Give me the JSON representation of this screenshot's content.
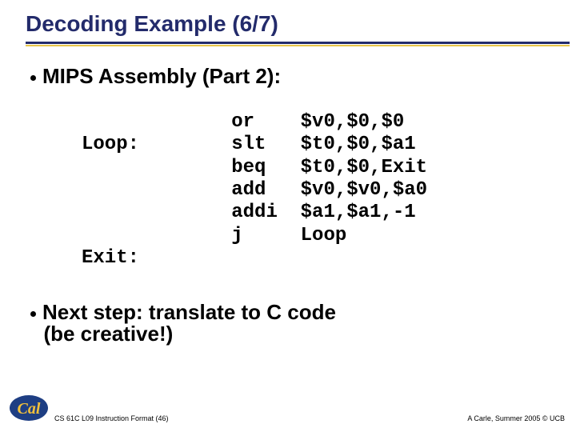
{
  "title": "Decoding Example (6/7)",
  "heading1": "MIPS Assembly (Part 2):",
  "code": "             or    $v0,$0,$0\nLoop:        slt   $t0,$0,$a1\n             beq   $t0,$0,Exit\n             add   $v0,$v0,$a0\n             addi  $a1,$a1,-1\n             j     Loop\nExit:",
  "heading2_line1": "Next step: translate to C code",
  "heading2_line2": "(be creative!)",
  "footer_left": "CS 61C L09 Instruction Format (46)",
  "footer_right": "A Carle, Summer 2005 © UCB",
  "chart_data": {
    "type": "table",
    "title": "MIPS Assembly (Part 2)",
    "columns": [
      "label",
      "instruction",
      "operands"
    ],
    "rows": [
      {
        "label": "",
        "instruction": "or",
        "operands": "$v0,$0,$0"
      },
      {
        "label": "Loop:",
        "instruction": "slt",
        "operands": "$t0,$0,$a1"
      },
      {
        "label": "",
        "instruction": "beq",
        "operands": "$t0,$0,Exit"
      },
      {
        "label": "",
        "instruction": "add",
        "operands": "$v0,$v0,$a0"
      },
      {
        "label": "",
        "instruction": "addi",
        "operands": "$a1,$a1,-1"
      },
      {
        "label": "",
        "instruction": "j",
        "operands": "Loop"
      },
      {
        "label": "Exit:",
        "instruction": "",
        "operands": ""
      }
    ]
  }
}
